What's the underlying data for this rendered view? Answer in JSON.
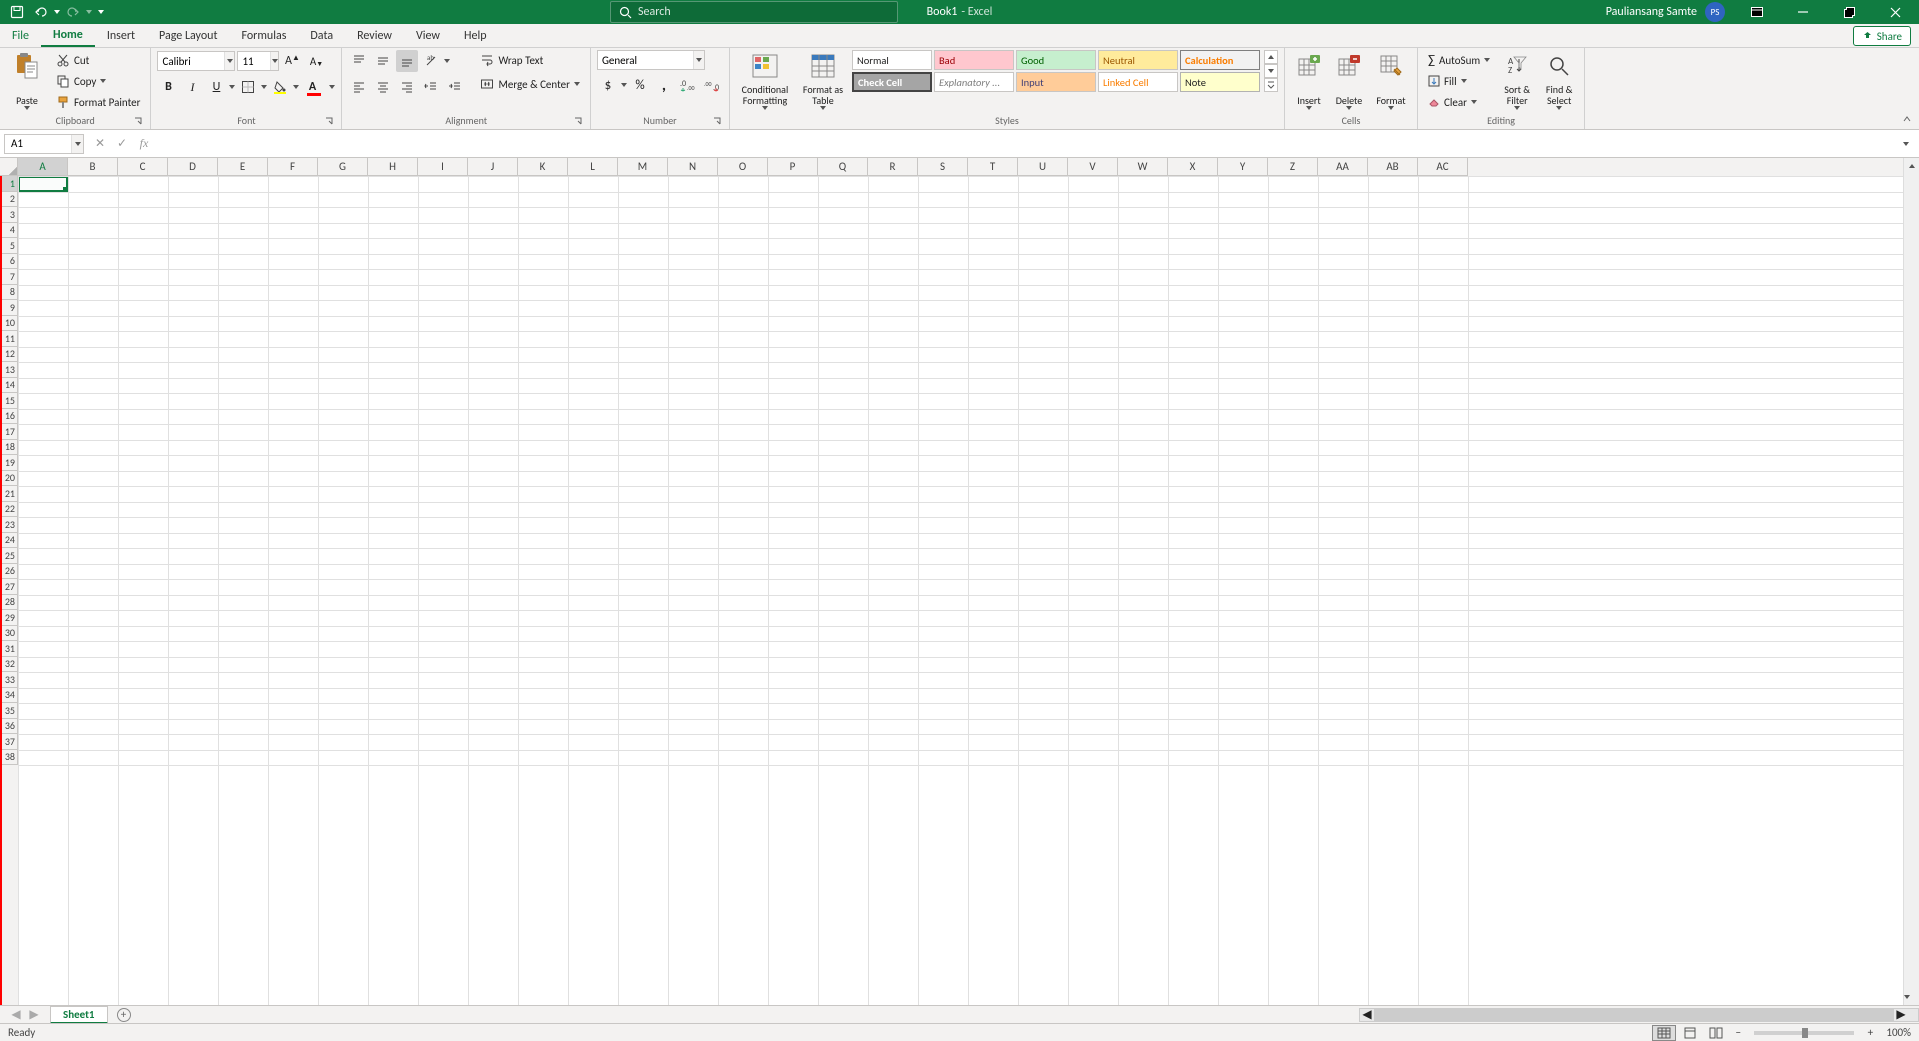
{
  "titlebar": {
    "doc_title": "Book1",
    "app_suffix": "-  Excel",
    "search_placeholder": "Search",
    "username": "Pauliansang Samte",
    "avatar_initials": "PS"
  },
  "tabs": {
    "file": "File",
    "home": "Home",
    "insert": "Insert",
    "page_layout": "Page Layout",
    "formulas": "Formulas",
    "data": "Data",
    "review": "Review",
    "view": "View",
    "help": "Help",
    "share": "Share"
  },
  "ribbon": {
    "clipboard": {
      "label": "Clipboard",
      "paste": "Paste",
      "cut": "Cut",
      "copy": "Copy",
      "format_painter": "Format Painter"
    },
    "font": {
      "label": "Font",
      "name": "Calibri",
      "size": "11"
    },
    "alignment": {
      "label": "Alignment",
      "wrap": "Wrap Text",
      "merge": "Merge & Center"
    },
    "number": {
      "label": "Number",
      "format": "General"
    },
    "styles": {
      "label": "Styles",
      "cond_fmt": "Conditional Formatting",
      "fmt_table": "Format as Table",
      "cells": [
        "Normal",
        "Bad",
        "Good",
        "Neutral",
        "Calculation",
        "Check Cell",
        "Explanatory ...",
        "Input",
        "Linked Cell",
        "Note"
      ]
    },
    "cells": {
      "label": "Cells",
      "insert": "Insert",
      "delete": "Delete",
      "format": "Format"
    },
    "editing": {
      "label": "Editing",
      "autosum": "AutoSum",
      "fill": "Fill",
      "clear": "Clear",
      "sort": "Sort & Filter",
      "find": "Find & Select"
    }
  },
  "formula_bar": {
    "namebox_value": "A1",
    "formula_value": ""
  },
  "grid": {
    "columns": [
      "A",
      "B",
      "C",
      "D",
      "E",
      "F",
      "G",
      "H",
      "I",
      "J",
      "K",
      "L",
      "M",
      "N",
      "O",
      "P",
      "Q",
      "R",
      "S",
      "T",
      "U",
      "V",
      "W",
      "X",
      "Y",
      "Z",
      "AA",
      "AB",
      "AC"
    ],
    "rows": [
      1,
      2,
      3,
      4,
      5,
      6,
      7,
      8,
      9,
      10,
      11,
      12,
      13,
      14,
      15,
      16,
      17,
      18,
      19,
      20,
      21,
      22,
      23,
      24,
      25,
      26,
      27,
      28,
      29,
      30,
      31,
      32,
      33,
      34,
      35,
      36,
      37,
      38
    ],
    "active_col": "A",
    "active_row": 1
  },
  "sheets": {
    "active": "Sheet1"
  },
  "statusbar": {
    "ready": "Ready",
    "zoom": "100%"
  }
}
